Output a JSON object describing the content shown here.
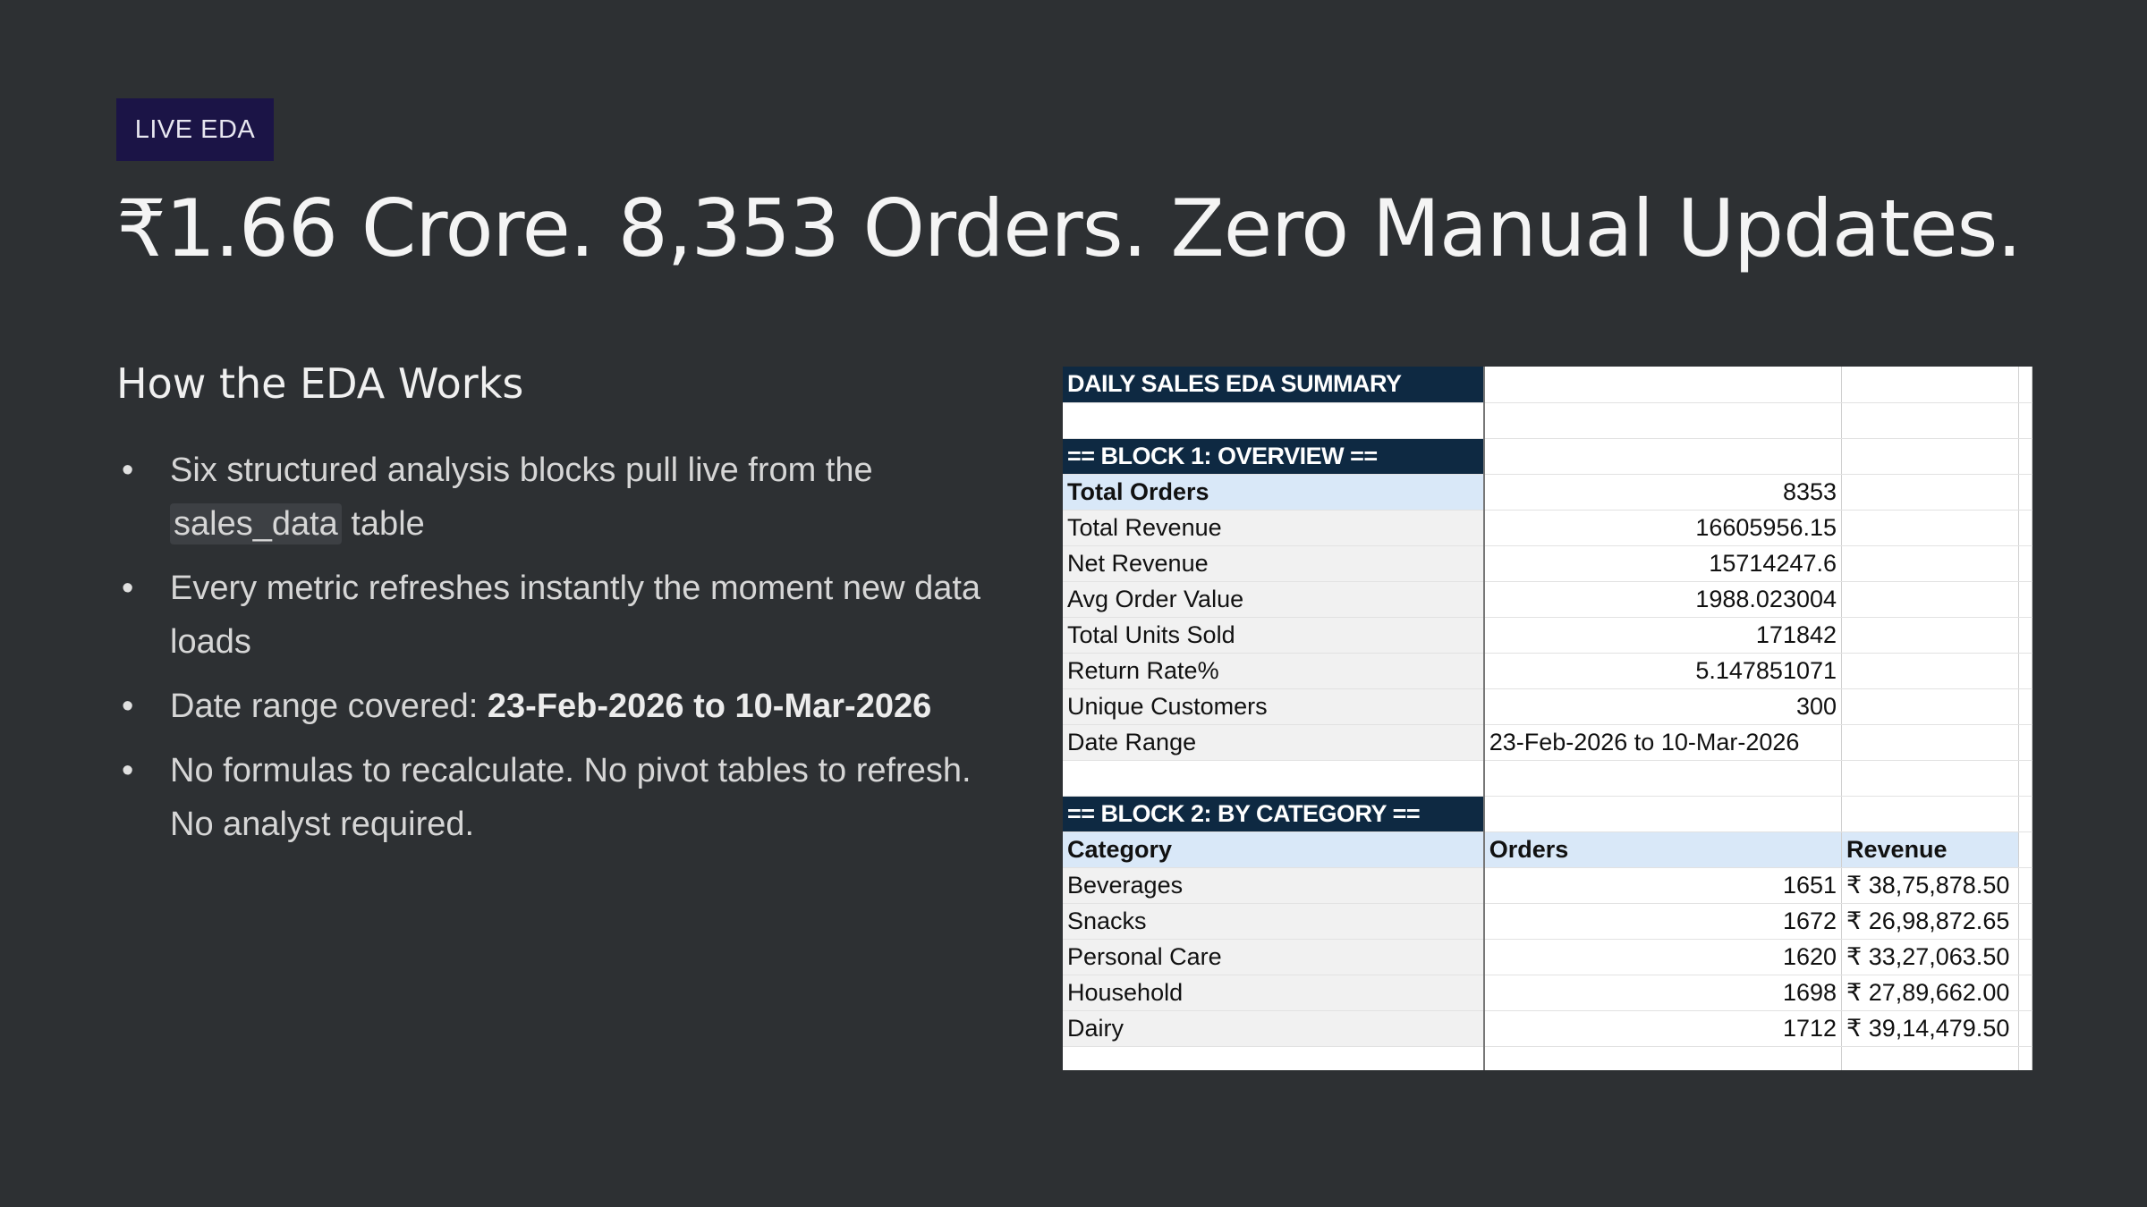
{
  "badge": "LIVE EDA",
  "headline": "₹1.66 Crore. 8,353 Orders. Zero Manual Updates.",
  "section_title": "How the EDA Works",
  "bullets": {
    "b1_text": "Six structured analysis blocks pull live from the",
    "b1_code": "sales_data",
    "b1_tail": " table",
    "b2_text": "Every metric refreshes instantly the moment new data loads",
    "b3_text": "Date range covered: ",
    "b3_bold": "23-Feb-2026 to 10-Mar-2026",
    "b4_text": "No formulas to recalculate. No pivot tables to refresh. No analyst required."
  },
  "sheet": {
    "title": "DAILY SALES EDA SUMMARY",
    "block1_header": "== BLOCK 1: OVERVIEW ==",
    "overview": [
      {
        "label": "Total Orders",
        "value": "8353"
      },
      {
        "label": "Total Revenue",
        "value": "16605956.15"
      },
      {
        "label": "Net Revenue",
        "value": "15714247.6"
      },
      {
        "label": "Avg Order Value",
        "value": "1988.023004"
      },
      {
        "label": "Total Units Sold",
        "value": "171842"
      },
      {
        "label": "Return Rate%",
        "value": "5.147851071"
      },
      {
        "label": "Unique Customers",
        "value": "300"
      },
      {
        "label": "Date Range",
        "value": "23-Feb-2026 to 10-Mar-2026"
      }
    ],
    "block2_header": "== BLOCK 2: BY CATEGORY ==",
    "category_headers": {
      "category": "Category",
      "orders": "Orders",
      "revenue": "Revenue"
    },
    "categories": [
      {
        "name": "Beverages",
        "orders": "1651",
        "revenue": "₹ 38,75,878.50"
      },
      {
        "name": "Snacks",
        "orders": "1672",
        "revenue": "₹ 26,98,872.65"
      },
      {
        "name": "Personal Care",
        "orders": "1620",
        "revenue": "₹ 33,27,063.50"
      },
      {
        "name": "Household",
        "orders": "1698",
        "revenue": "₹ 27,89,662.00"
      },
      {
        "name": "Dairy",
        "orders": "1712",
        "revenue": "₹ 39,14,479.50"
      }
    ]
  },
  "colors": {
    "background": "#2d3033",
    "badge_bg": "#1b1446",
    "sheet_header_bg": "#0e2942",
    "sheet_highlight_bg": "#d9e8f8"
  }
}
